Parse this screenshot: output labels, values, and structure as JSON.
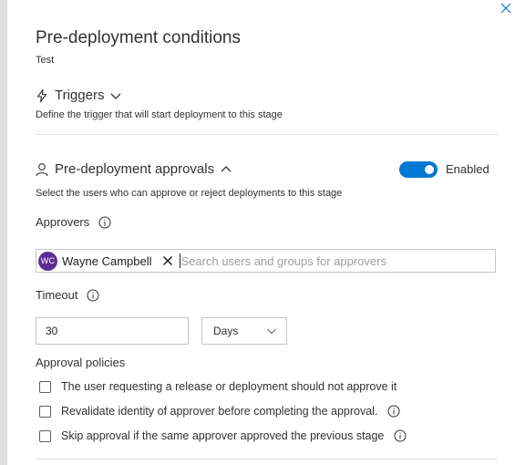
{
  "panel": {
    "title": "Pre-deployment conditions",
    "subtitle": "Test"
  },
  "triggers": {
    "label": "Triggers",
    "description": "Define the trigger that will start deployment to this stage",
    "icon": "lightning-icon"
  },
  "approvals": {
    "label": "Pre-deployment approvals",
    "description": "Select the users who can approve or reject deployments to this stage",
    "toggle_label": "Enabled",
    "toggle_on": true,
    "accent_color": "#0078d4",
    "approvers_label": "Approvers",
    "approvers": [
      {
        "initials": "WC",
        "name": "Wayne Campbell",
        "avatar_color": "#5c2e91"
      }
    ],
    "search_placeholder": "Search users and groups for approvers",
    "timeout_label": "Timeout",
    "timeout_value": "30",
    "timeout_unit": "Days",
    "policies_label": "Approval policies",
    "policies": [
      {
        "label": "The user requesting a release or deployment should not approve it",
        "checked": false,
        "info": false
      },
      {
        "label": "Revalidate identity of approver before completing the approval.",
        "checked": false,
        "info": true
      },
      {
        "label": "Skip approval if the same approver approved the previous stage",
        "checked": false,
        "info": true
      }
    ]
  }
}
